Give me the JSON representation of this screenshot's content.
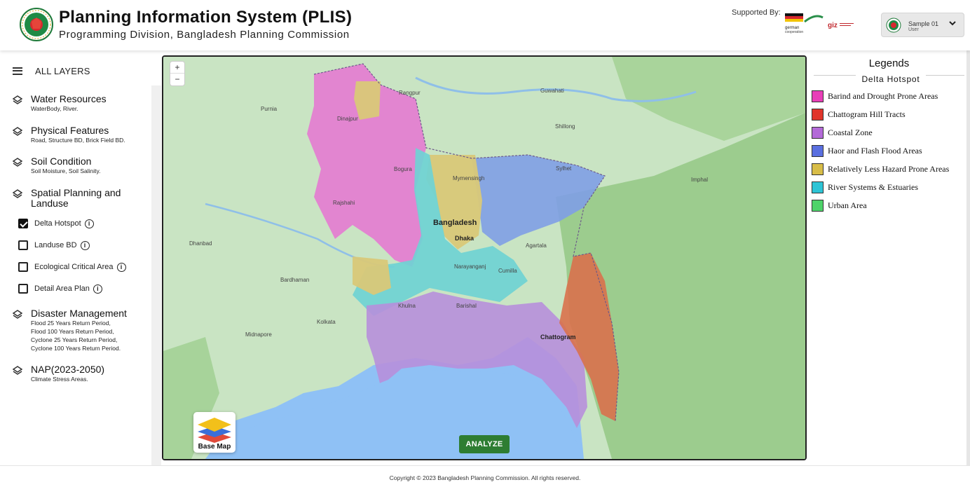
{
  "header": {
    "title": "Planning Information System (PLIS)",
    "subtitle": "Programming Division, Bangladesh Planning Commission",
    "supported_by": "Supported By:",
    "logo_icon": "bangladesh-government-seal",
    "sponsor_1": "german cooperation",
    "sponsor_2": "giz"
  },
  "user": {
    "name": "Sample 01",
    "role": "User",
    "chevron": "chevron-down-icon"
  },
  "sidebar": {
    "header_label": "ALL LAYERS",
    "groups": [
      {
        "title": "Water Resources",
        "desc": "WaterBody, River."
      },
      {
        "title": "Physical Features",
        "desc": "Road, Structure BD, Brick Field BD."
      },
      {
        "title": "Soil Condition",
        "desc": "Soil Moisture, Soil Salinity."
      },
      {
        "title": "Spatial Planning and Landuse",
        "desc": ""
      },
      {
        "title": "Disaster Management",
        "desc_lines": [
          "Flood 25 Years Return Period,",
          "Flood 100 Years Return Period,",
          "Cyclone 25 Years Return Period,",
          "Cyclone 100 Years Return Period."
        ]
      },
      {
        "title": "NAP(2023-2050)",
        "desc": "Climate Stress Areas."
      }
    ],
    "layers": [
      {
        "label": "Delta Hotspot",
        "checked": true
      },
      {
        "label": "Landuse BD",
        "checked": false
      },
      {
        "label": "Ecological Critical Area",
        "checked": false
      },
      {
        "label": "Detail Area Plan",
        "checked": false
      }
    ],
    "info_glyph": "i"
  },
  "map": {
    "zoom_in": "+",
    "zoom_out": "−",
    "basemap_label": "Base Map",
    "analyze_label": "ANALYZE",
    "labels": {
      "country": "Bangladesh",
      "dhaka": "Dhaka",
      "chattogram": "Chattogram",
      "sylhet": "Sylhet",
      "rajshahi": "Rajshahi",
      "khulna": "Khulna",
      "kolkata": "Kolkata",
      "guwahati": "Guwahati",
      "shillong": "Shillong",
      "agartala": "Agartala",
      "mymensingh": "Mymensingh",
      "bogura": "Bogura",
      "dinajpur": "Dinajpur",
      "cumilla": "Cumilla",
      "barishal": "Barishal",
      "rangpur": "Rangpur",
      "narayanganj": "Narayanganj",
      "imphal": "Imphal",
      "purnia": "Purnia",
      "bardhaman": "Bardhaman",
      "dhanbad": "Dhanbad",
      "midnapore": "Midnapore"
    },
    "colors": {
      "sea": "#8fc1f5",
      "land": "#c9e4c3",
      "forest": "#9ccc8e",
      "barind": "#e47ad1",
      "chattogram_hill": "#d9714d",
      "coastal": "#b78fdc",
      "haor": "#7f9ee6",
      "less_hazard": "#d9c878",
      "river": "#6fd3d4"
    }
  },
  "legend": {
    "title": "Legends",
    "subtitle": "Delta Hotspot",
    "items": [
      {
        "label": "Barind and Drought Prone Areas",
        "color": "#e83fb8"
      },
      {
        "label": "Chattogram Hill Tracts",
        "color": "#e0352b"
      },
      {
        "label": "Coastal Zone",
        "color": "#b36ad8"
      },
      {
        "label": "Haor and Flash Flood Areas",
        "color": "#5a6fe0"
      },
      {
        "label": "Relatively Less Hazard Prone Areas",
        "color": "#d8bd48"
      },
      {
        "label": "River Systems & Estuaries",
        "color": "#2ec4d6"
      },
      {
        "label": "Urban Area",
        "color": "#4ed36a"
      }
    ]
  },
  "footer": {
    "copyright": "Copyright © 2023 Bangladesh Planning Commission. All rights reserved."
  }
}
